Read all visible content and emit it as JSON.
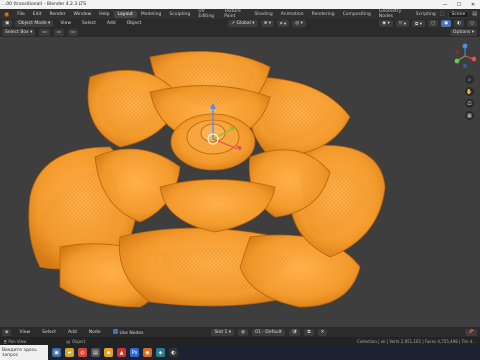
{
  "window": {
    "title": "...00 (transitional) - Blender 4.2.3 LTS",
    "min": "—",
    "max": "☐",
    "close": "✕"
  },
  "topbar": {
    "menus": [
      "File",
      "Edit",
      "Render",
      "Window",
      "Help"
    ],
    "tabs": [
      "Layout",
      "Modeling",
      "Sculpting",
      "UV Editing",
      "Texture Paint",
      "Shading",
      "Animation",
      "Rendering",
      "Compositing",
      "Geometry Nodes",
      "Scripting"
    ],
    "active_tab": "Layout",
    "scene_label": "Scene"
  },
  "header": {
    "mode": "Object Mode",
    "view": "View",
    "select": "Select",
    "add": "Add",
    "object": "Object",
    "transform": "Global",
    "options": "Options"
  },
  "header3": {
    "select_box": "Select Box"
  },
  "footer": {
    "view": "View",
    "select": "Select",
    "add": "Add",
    "node": "Node",
    "use_nodes": "Use Nodes",
    "slot": "Slot 1",
    "material": "01 - Default"
  },
  "status": {
    "pan": "Pan View",
    "context": "Object",
    "stats": "Collection | oil | Verts 2,951,161 | Faces 4,755,498 | Tris 4..."
  },
  "taskbar": {
    "search": "Введите здесь запрос"
  },
  "colors": {
    "accent": "#ee9b2a",
    "active_tab": "#464646"
  }
}
